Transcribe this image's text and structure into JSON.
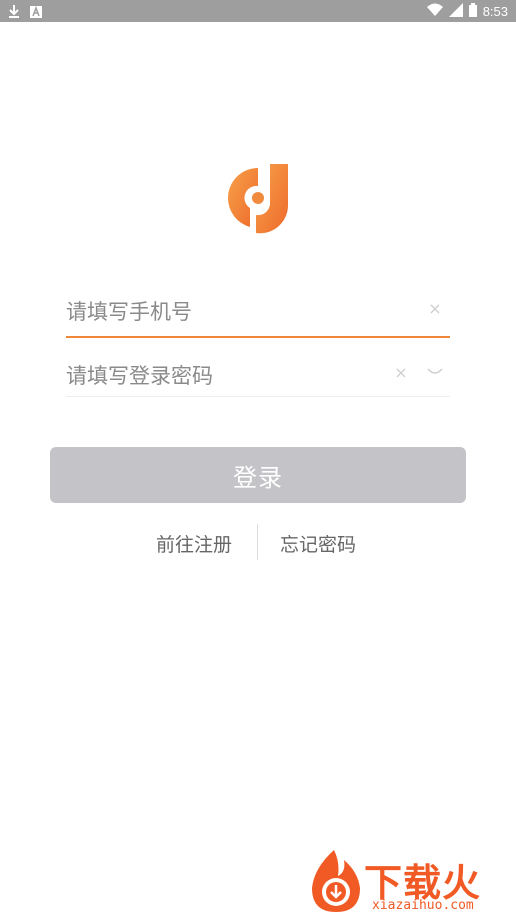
{
  "status_bar": {
    "time": "8:53",
    "icons": [
      "download-icon",
      "notification-a-icon",
      "wifi-icon",
      "signal-icon",
      "battery-icon"
    ]
  },
  "login": {
    "phone_placeholder": "请填写手机号",
    "password_placeholder": "请填写登录密码",
    "login_label": "登录",
    "register_label": "前往注册",
    "forgot_label": "忘记密码"
  },
  "watermark": {
    "brand": "下载火",
    "url": "xiazaihuo.com"
  },
  "colors": {
    "accent": "#f0883a",
    "button_disabled": "#c4c4c8",
    "watermark": "#f15a24"
  }
}
